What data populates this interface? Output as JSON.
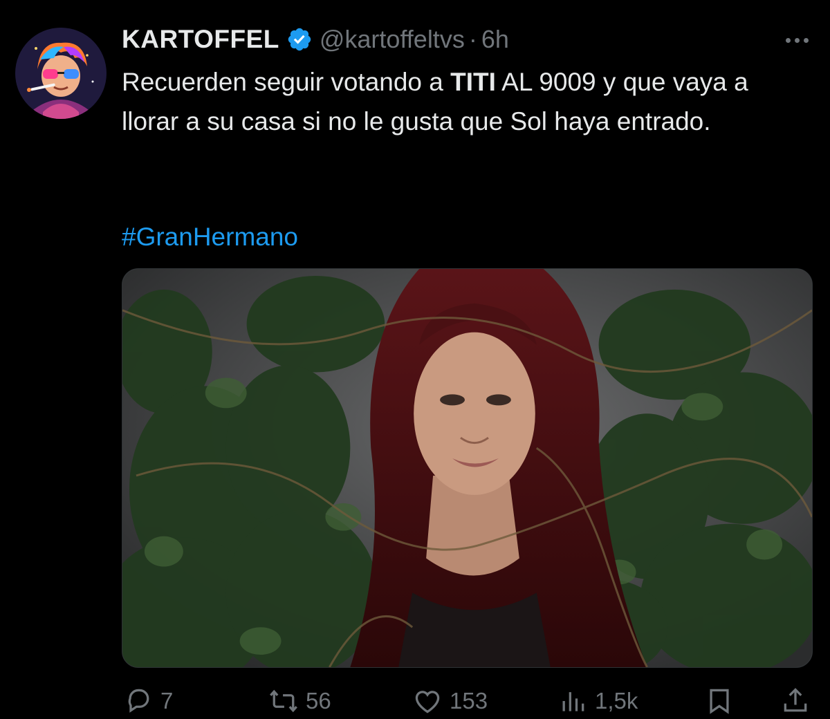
{
  "tweet": {
    "author": {
      "name": "KARTOFFEL",
      "handle": "@kartoffeltvs",
      "separator": "·",
      "time": "6h",
      "verified": true
    },
    "text": {
      "part1": "Recuerden seguir votando a ",
      "bold": "TITI",
      "part2": " AL 9009 y que vaya a llorar a su casa si no le gusta que Sol haya entrado."
    },
    "hashtag": "#GranHermano",
    "media_icon": "photo-woman-ivy",
    "actions": {
      "replies": "7",
      "reposts": "56",
      "likes": "153",
      "views": "1,5k"
    }
  },
  "icons": {
    "more": "more-dots-icon",
    "reply": "reply-icon",
    "repost": "repost-icon",
    "like": "heart-icon",
    "views": "views-icon",
    "bookmark": "bookmark-icon",
    "share": "share-icon",
    "verified": "verified-badge-icon"
  },
  "colors": {
    "background": "#000000",
    "text": "#e7e9ea",
    "muted": "#71767b",
    "link": "#1d9bf0"
  }
}
